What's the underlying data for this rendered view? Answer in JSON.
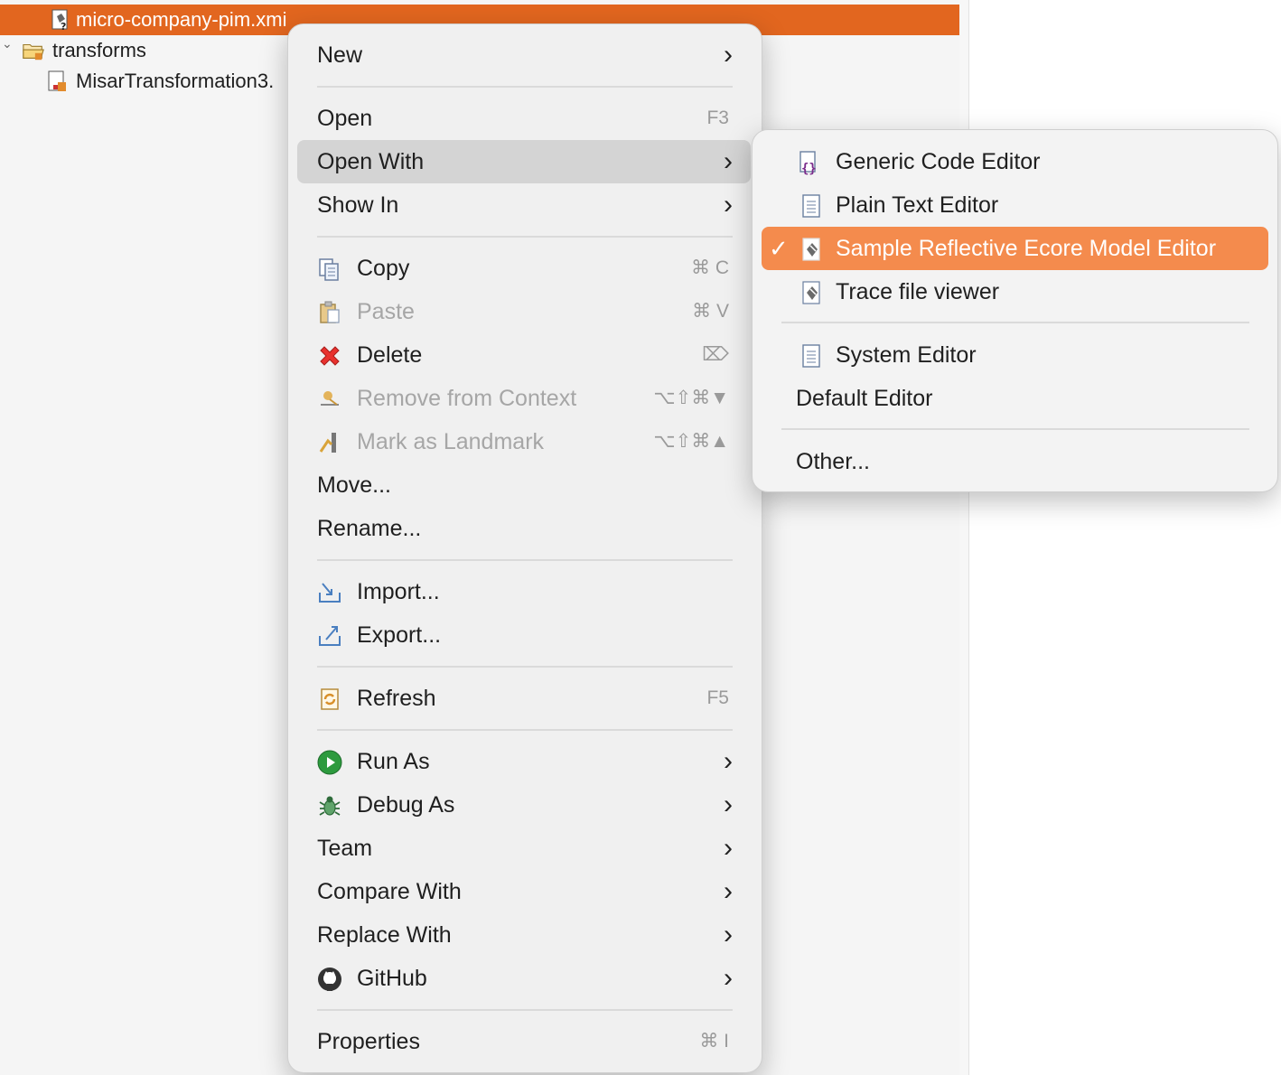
{
  "explorer": {
    "rows": [
      {
        "label": "micro-company-pim.xmi",
        "selected": true
      },
      {
        "label": "transforms"
      },
      {
        "label": "MisarTransformation3."
      }
    ]
  },
  "context_menu": {
    "new": "New",
    "open": "Open",
    "open_sc": "F3",
    "open_with": "Open With",
    "show_in": "Show In",
    "copy": "Copy",
    "copy_sc": "⌘ C",
    "paste": "Paste",
    "paste_sc": "⌘ V",
    "delete": "Delete",
    "delete_sc": "⌦",
    "remove_ctx": "Remove from Context",
    "remove_ctx_sc": "⌥⇧⌘▼",
    "mark": "Mark as Landmark",
    "mark_sc": "⌥⇧⌘▲",
    "move": "Move...",
    "rename": "Rename...",
    "import": "Import...",
    "export": "Export...",
    "refresh": "Refresh",
    "refresh_sc": "F5",
    "run_as": "Run As",
    "debug_as": "Debug As",
    "team": "Team",
    "compare_with": "Compare With",
    "replace_with": "Replace With",
    "github": "GitHub",
    "properties": "Properties",
    "properties_sc": "⌘ I"
  },
  "submenu": {
    "generic": "Generic Code Editor",
    "plain": "Plain Text Editor",
    "checkmark": "✓",
    "reflective": "Sample Reflective Ecore Model Editor",
    "trace": "Trace file viewer",
    "system": "System Editor",
    "default": "Default Editor",
    "other": "Other..."
  },
  "colors": {
    "selection": "#e2661f",
    "submenu_selection": "#f48b4d",
    "hover": "#d4d4d4"
  }
}
